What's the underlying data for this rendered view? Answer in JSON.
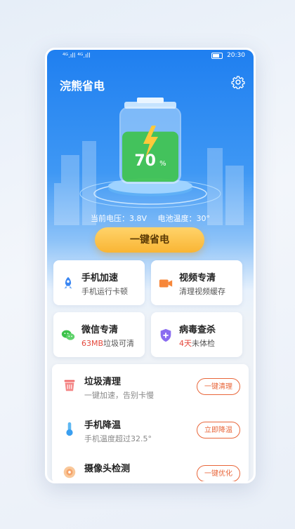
{
  "status_bar": {
    "signal_text": "⁴ᴳ.ıll ⁴ᴳ.ıll",
    "time": "20:30"
  },
  "header": {
    "title": "浣熊省电",
    "settings_icon": "gear-icon"
  },
  "battery": {
    "percent_label": "70",
    "percent_unit": "%",
    "level": 0.7,
    "voltage_label": "当前电压：3.8V",
    "temperature_label": "电池温度：30°"
  },
  "cta": {
    "label": "一键省电"
  },
  "feature_cards": [
    {
      "title": "手机加速",
      "subtitle": "手机运行卡顿",
      "icon": "rocket-icon"
    },
    {
      "title": "视频专清",
      "subtitle": "清理视频缓存",
      "icon": "video-camera-icon"
    },
    {
      "title": "微信专清",
      "subtitle_highlight": "63MB",
      "subtitle_rest": "垃圾可清",
      "icon": "wechat-icon"
    },
    {
      "title": "病毒查杀",
      "subtitle_highlight": "4天",
      "subtitle_rest": "未体检",
      "icon": "shield-plus-icon"
    }
  ],
  "tools": [
    {
      "title": "垃圾清理",
      "subtitle": "一键加速，告别卡慢",
      "button": "一键清理",
      "icon": "trash-bin-icon"
    },
    {
      "title": "手机降温",
      "subtitle": "手机温度超过32.5°",
      "button": "立即降温",
      "icon": "thermometer-icon"
    },
    {
      "title": "摄像头检测",
      "subtitle": "",
      "button": "一键优化",
      "icon": "camera-icon"
    }
  ],
  "colors": {
    "primary_blue": "#1f7ff0",
    "battery_green": "#3cc24a",
    "cta_yellow": "#f9b534",
    "accent_orange": "#e8663a",
    "alert_red": "#e4473b"
  }
}
